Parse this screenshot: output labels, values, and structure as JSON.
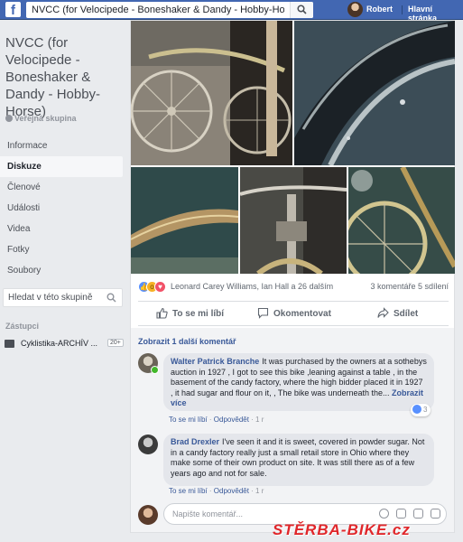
{
  "topbar": {
    "search_value": "NVCC (for Velocipede - Boneshaker & Dandy - Hobby-Horse)",
    "user_name": "Robert",
    "home_label": "Hlavní stránka"
  },
  "group": {
    "title": "NVCC (for Velocipede - Boneshaker & Dandy - Hobby-Horse)",
    "type": "Veřejná skupina",
    "nav": [
      "Informace",
      "Diskuze",
      "Členové",
      "Události",
      "Videa",
      "Fotky",
      "Soubory"
    ],
    "active_nav": "Diskuze",
    "search_placeholder": "Hledat v této skupině",
    "shortcuts_label": "Zástupci",
    "shortcut": {
      "label": "Cyklistika-ARCHÍV ...",
      "count": "20+"
    }
  },
  "post": {
    "reactions_names": "Leonard Carey Williams, Ian Hall a 26 dalším",
    "counts": "3 komentáře  5 sdílení",
    "actions": {
      "like": "To se mi líbí",
      "comment": "Okomentovat",
      "share": "Sdílet"
    },
    "more_comments": "Zobrazit 1 další komentář"
  },
  "comments": [
    {
      "author": "Walter Patrick Branche",
      "text": "It was purchased by the owners at a sothebys auction in 1927 , I got to see this bike ,leaning against a table , in the basement of the candy factory, where the high bidder placed it in 1927 , it had sugar and flour on it, , The bike was underneath the...",
      "see_more": "Zobrazit více",
      "like": "To se mi líbí",
      "reply": "Odpovědět",
      "age": "1 r",
      "likes": "3"
    },
    {
      "author": "Brad Drexler",
      "text": "I've seen it and it is sweet, covered in powder sugar. Not in a candy factory really just a small retail store in Ohio where they make some of their own product on site. It was still there as of a few years ago and not for sale.",
      "like": "To se mi líbí",
      "reply": "Odpovědět",
      "age": "1 r"
    }
  ],
  "compose": {
    "placeholder": "Napište komentář..."
  },
  "watermark": {
    "prefix": "STĚRBA",
    "suffix": "-BIKE.cz"
  },
  "colors": {
    "brand": "#4267b2",
    "link": "#385898",
    "watermark": "#e0262a"
  }
}
